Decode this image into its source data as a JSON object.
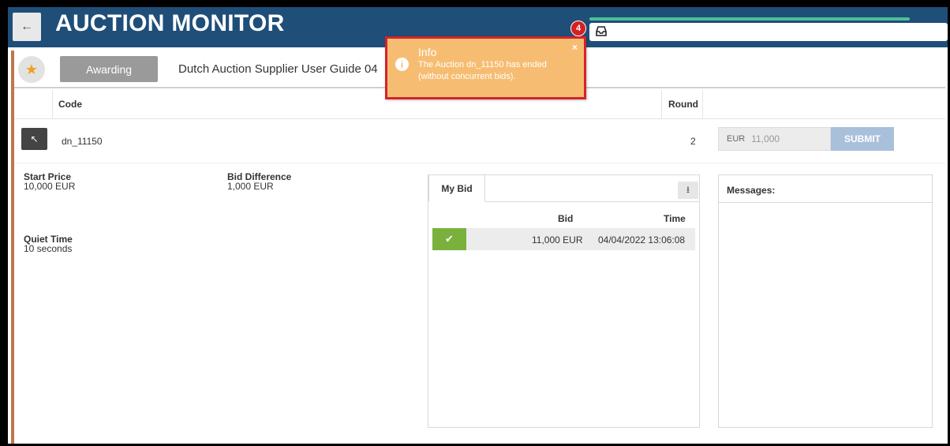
{
  "header": {
    "back_icon": "arrow-left-icon",
    "title": "AUCTION MONITOR",
    "notification_count": "4",
    "inbox_icon": "inbox-icon",
    "accent_color": "#1f4e79",
    "progress_color": "#4bc19a"
  },
  "toast": {
    "title": "Info",
    "message": "The Auction dn_11150 has ended (without concurrent bids).",
    "close": "×",
    "icon": "info-icon",
    "color": "#f6bd72"
  },
  "auction": {
    "status": "Awarding",
    "name": "Dutch Auction Supplier User Guide 04",
    "favorite_icon": "star-icon"
  },
  "table": {
    "headers": {
      "code": "Code",
      "round": "Round"
    },
    "row": {
      "code": "dn_11150",
      "round": "2",
      "currency": "EUR",
      "bid_value": "11,000",
      "submit": "SUBMIT"
    }
  },
  "details": {
    "start_price_label": "Start Price",
    "start_price": "10,000 EUR",
    "bid_difference_label": "Bid Difference",
    "bid_difference": "1,000 EUR",
    "quiet_time_label": "Quiet Time",
    "quiet_time": "10 seconds"
  },
  "my_bid": {
    "tab": "My Bid",
    "headers": {
      "bid": "Bid",
      "time": "Time"
    },
    "rows": [
      {
        "amount": "11,000 EUR",
        "time": "04/04/2022 13:06:08",
        "status_icon": "check-icon"
      }
    ]
  },
  "messages": {
    "title": "Messages:"
  }
}
